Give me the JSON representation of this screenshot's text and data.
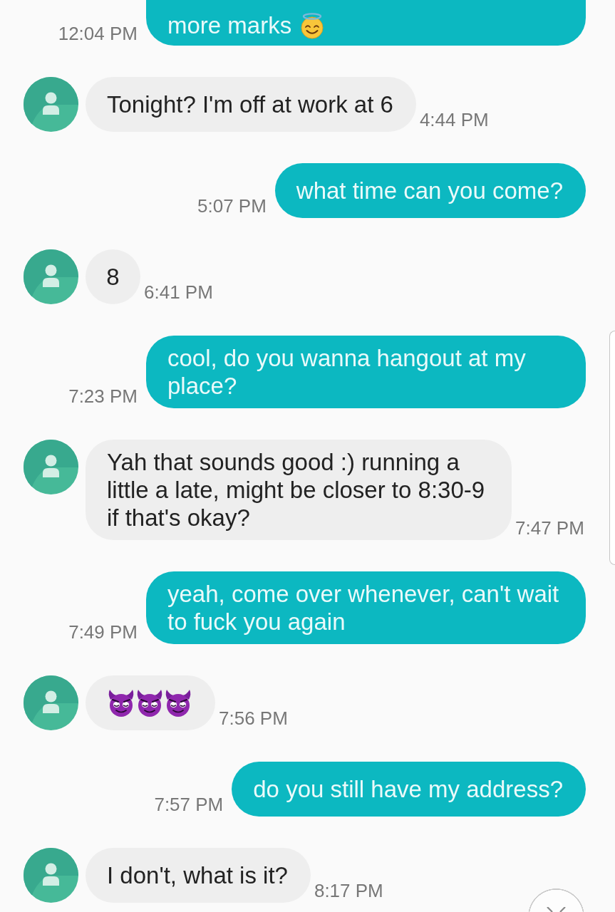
{
  "messages": [
    {
      "kind": "sent",
      "text": "more marks",
      "emojis": [
        {
          "kind": "halo_smile"
        }
      ],
      "time": "12:04 PM"
    },
    {
      "kind": "received",
      "text": "Tonight? I'm off at work at 6",
      "time": "4:44 PM"
    },
    {
      "kind": "sent",
      "text": "what time can you come?",
      "time": "5:07 PM"
    },
    {
      "kind": "received",
      "text": "8",
      "time": "6:41 PM"
    },
    {
      "kind": "sent",
      "text": "cool, do you wanna hangout at my place?",
      "time": "7:23 PM"
    },
    {
      "kind": "received",
      "text": "Yah that sounds good :) running a little a late, might be closer to 8:30-9 if that's okay?",
      "time": "7:47 PM"
    },
    {
      "kind": "sent",
      "text": "yeah, come over whenever, can't wait to fuck you again",
      "time": "7:49 PM"
    },
    {
      "kind": "received",
      "emojis": [
        {
          "kind": "devil"
        },
        {
          "kind": "devil"
        },
        {
          "kind": "devil"
        }
      ],
      "time": "7:56 PM"
    },
    {
      "kind": "sent",
      "text": "do you still have my address?",
      "time": "7:57 PM"
    },
    {
      "kind": "received",
      "text": "I don't, what is it?",
      "time": "8:17 PM"
    }
  ]
}
